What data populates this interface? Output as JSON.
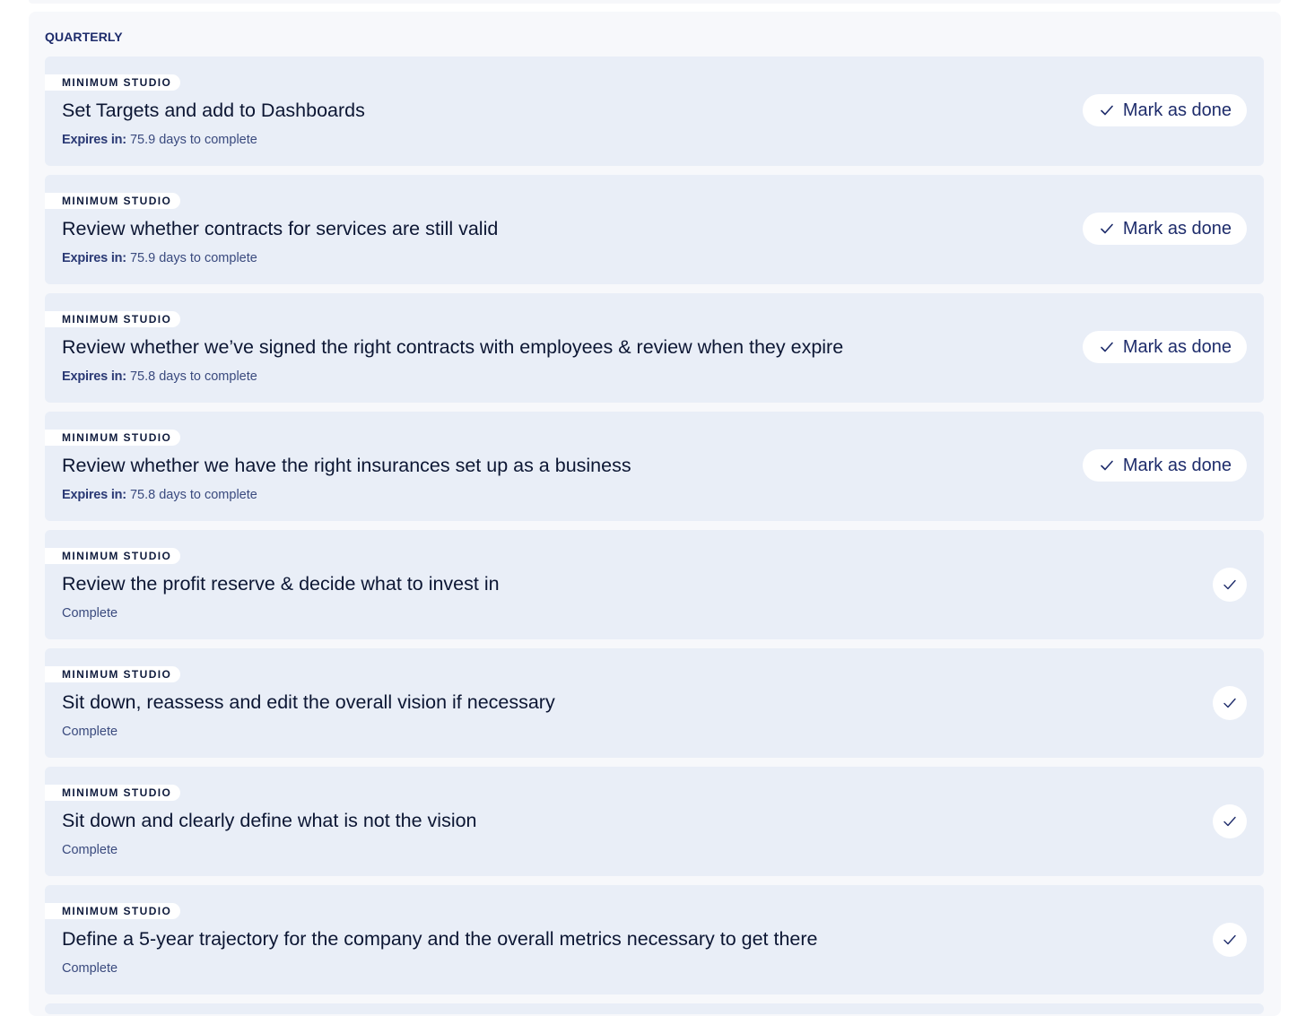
{
  "section": {
    "title": "QUARTERLY"
  },
  "tasks": [
    {
      "org": "MINIMUM STUDIO",
      "title": "Set Targets and add to Dashboards",
      "status": "pending",
      "meta_label": "Expires in:",
      "meta_value": "75.9 days to complete",
      "action_label": "Mark as done"
    },
    {
      "org": "MINIMUM STUDIO",
      "title": "Review whether contracts for services are still valid",
      "status": "pending",
      "meta_label": "Expires in:",
      "meta_value": "75.9 days to complete",
      "action_label": "Mark as done"
    },
    {
      "org": "MINIMUM STUDIO",
      "title": "Review whether we’ve signed the right contracts with employees & review when they expire",
      "status": "pending",
      "meta_label": "Expires in:",
      "meta_value": "75.8 days to complete",
      "action_label": "Mark as done"
    },
    {
      "org": "MINIMUM STUDIO",
      "title": "Review whether we have the right insurances set up as a business",
      "status": "pending",
      "meta_label": "Expires in:",
      "meta_value": "75.8 days to complete",
      "action_label": "Mark as done"
    },
    {
      "org": "MINIMUM STUDIO",
      "title": "Review the profit reserve & decide what to invest in",
      "status": "complete",
      "meta_label": "",
      "meta_value": "Complete",
      "action_label": ""
    },
    {
      "org": "MINIMUM STUDIO",
      "title": "Sit down, reassess and edit the overall vision if necessary",
      "status": "complete",
      "meta_label": "",
      "meta_value": "Complete",
      "action_label": ""
    },
    {
      "org": "MINIMUM STUDIO",
      "title": "Sit down and clearly define what is not the vision",
      "status": "complete",
      "meta_label": "",
      "meta_value": "Complete",
      "action_label": ""
    },
    {
      "org": "MINIMUM STUDIO",
      "title": "Define a 5-year trajectory for the company and the overall metrics necessary to get there",
      "status": "complete",
      "meta_label": "",
      "meta_value": "Complete",
      "action_label": ""
    }
  ],
  "icons": {
    "check": "check-icon"
  },
  "colors": {
    "card_bg": "#e9eef7",
    "section_bg": "#f7f8fb",
    "accent_text": "#1e2c6b"
  }
}
